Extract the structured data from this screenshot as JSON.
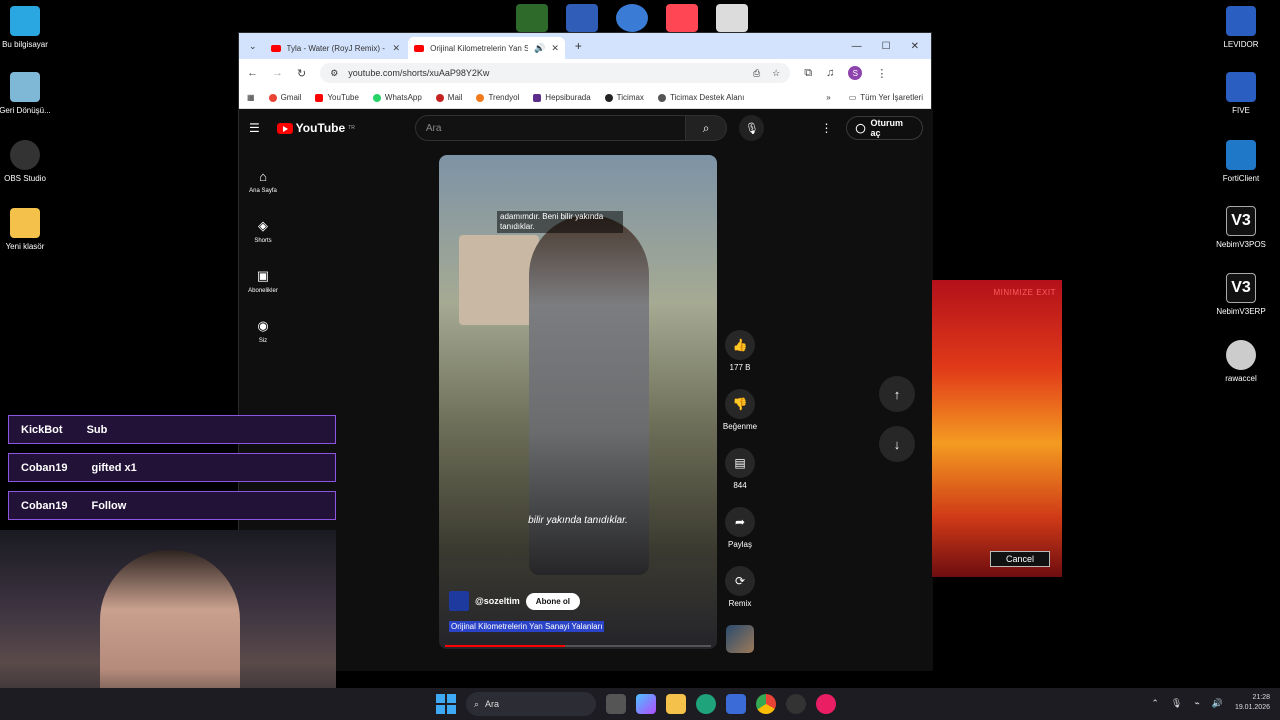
{
  "desktop": {
    "left_icons": [
      {
        "label": "Bu bilgisayar"
      },
      {
        "label": "Geri Dönüşü..."
      },
      {
        "label": "OBS Studio"
      },
      {
        "label": "Yeni klasör"
      }
    ],
    "right_icons": [
      {
        "label": "LEVIDOR"
      },
      {
        "label": "FIVE"
      },
      {
        "label": "FortiClient"
      },
      {
        "label": "NebimV3POS"
      },
      {
        "label": "NebimV3ERP"
      },
      {
        "label": "rawaccel"
      }
    ]
  },
  "browser": {
    "tabs": [
      {
        "title": "Tyla - Water (RoyJ Remix) - You"
      },
      {
        "title": "Orijinal Kilometrelerin Yan S"
      }
    ],
    "url": "youtube.com/shorts/xuAaP98Y2Kw",
    "bookmarks": [
      "Gmail",
      "YouTube",
      "WhatsApp",
      "Mail",
      "Trendyol",
      "Hepsiburada",
      "Ticimax",
      "Ticimax Destek Alanı"
    ],
    "all_bookmarks": "Tüm Yer İşaretleri",
    "profile_initial": "S"
  },
  "youtube": {
    "logo": "YouTube",
    "region": "TR",
    "search_placeholder": "Ara",
    "signin": "Oturum aç",
    "sidebar": [
      {
        "label": "Ana Sayfa"
      },
      {
        "label": "Shorts"
      },
      {
        "label": "Abonelikler"
      },
      {
        "label": "Siz"
      }
    ],
    "short": {
      "caption_top": "adamımdır. Beni bilir yakında tanıdıklar.",
      "caption_mid": "bilir yakında tanıdıklar.",
      "channel": "@sozeltim",
      "subscribe": "Abone ol",
      "title": "Orijinal Kilometrelerin Yan Sanayi Yalanları",
      "progress": 0.45
    },
    "actions": [
      {
        "label": "177 B"
      },
      {
        "label": "Beğenme"
      },
      {
        "label": "844"
      },
      {
        "label": "Paylaş"
      },
      {
        "label": "Remix"
      }
    ]
  },
  "popup": {
    "title": "MINIMIZE EXIT",
    "cancel": "Cancel"
  },
  "stream_alerts": [
    {
      "user": "KickBot",
      "event": "Sub"
    },
    {
      "user": "Coban19",
      "event": "gifted x1"
    },
    {
      "user": "Coban19",
      "event": "Follow"
    }
  ],
  "taskbar": {
    "search_label": "Ara",
    "time": "21:28",
    "date": "19.01.2026"
  }
}
